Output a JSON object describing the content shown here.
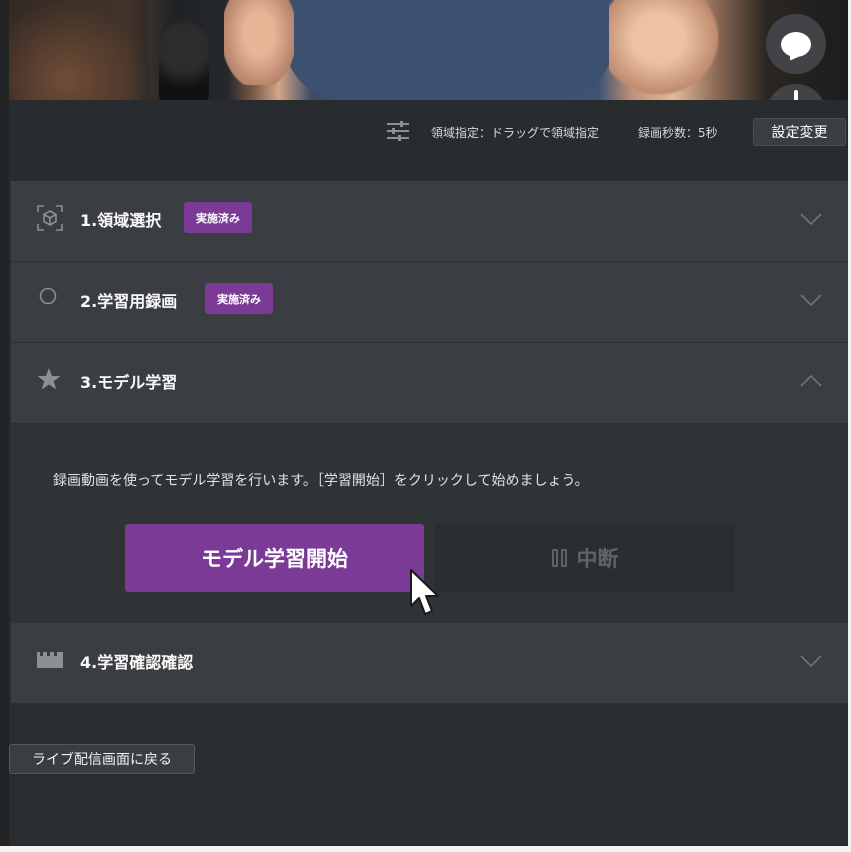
{
  "settings": {
    "region_text": "領域指定：ドラッグで領域指定",
    "seconds_text": "録画秒数：5秒",
    "change_button": "設定変更"
  },
  "steps": [
    {
      "title": "1.領域選択",
      "badge": "実施済み",
      "icon": "region-select-icon",
      "expanded": false
    },
    {
      "title": "2.学習用録画",
      "badge": "実施済み",
      "icon": "record-circle-icon",
      "expanded": false
    },
    {
      "title": "3.モデル学習",
      "badge": "",
      "icon": "star-icon",
      "expanded": true
    },
    {
      "title": "4.学習確認確認",
      "badge": "",
      "icon": "clapperboard-icon",
      "expanded": false
    }
  ],
  "model_training": {
    "description": "録画動画を使ってモデル学習を行います。［学習開始］をクリックして始めましょう。",
    "start_button": "モデル学習開始",
    "pause_button": "中断"
  },
  "back_button": "ライブ配信画面に戻る",
  "colors": {
    "accent": "#7b3a96",
    "panel": "#3a3d41",
    "background": "#2a2d30"
  }
}
